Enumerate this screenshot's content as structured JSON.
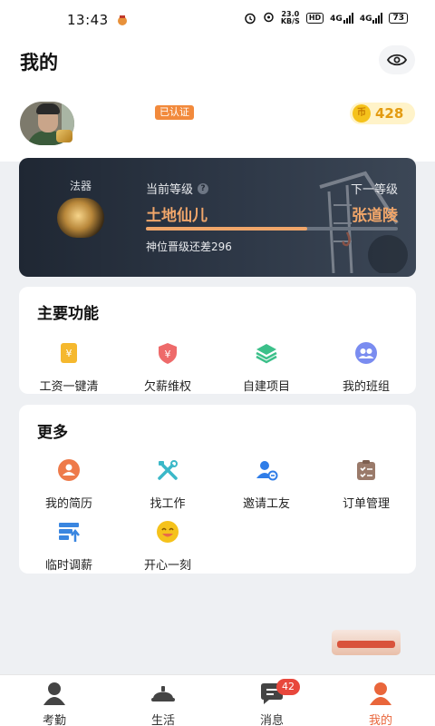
{
  "status_bar": {
    "time": "13:43",
    "net_speed_value": "23.0",
    "net_speed_unit": "KB/S",
    "hd_label": "HD",
    "signal_1": "4G",
    "signal_2": "4G",
    "battery": "73"
  },
  "header": {
    "title": "我的",
    "eye_icon": "eye-icon"
  },
  "profile": {
    "verified_label": "已认证",
    "coins": "428",
    "coin_symbol": "币"
  },
  "level_card": {
    "artifact_label": "法器",
    "current_label": "当前等级",
    "next_label": "下一等级",
    "current_level": "土地仙儿",
    "next_level": "张道陵",
    "progress_text": "神位晋级还差296",
    "progress_fraction": 0.64
  },
  "main_functions": {
    "title": "主要功能",
    "items": [
      {
        "label": "工资一键清",
        "icon": "salary-scroll-icon",
        "color": "#f5b82e"
      },
      {
        "label": "欠薪维权",
        "icon": "shield-yen-icon",
        "color": "#ee6a6a"
      },
      {
        "label": "自建项目",
        "icon": "layers-icon",
        "color": "#3cc08a"
      },
      {
        "label": "我的班组",
        "icon": "team-icon",
        "color": "#7a8cf0"
      }
    ]
  },
  "more": {
    "title": "更多",
    "items": [
      {
        "label": "我的简历",
        "icon": "resume-icon",
        "color": "#ee7a4a"
      },
      {
        "label": "找工作",
        "icon": "tools-icon",
        "color": "#3bb8c8"
      },
      {
        "label": "邀请工友",
        "icon": "invite-user-icon",
        "color": "#2f7de8"
      },
      {
        "label": "订单管理",
        "icon": "clipboard-icon",
        "color": "#9a7a6a"
      },
      {
        "label": "临时调薪",
        "icon": "salary-adjust-icon",
        "color": "#3a86e0"
      },
      {
        "label": "开心一刻",
        "icon": "smile-icon",
        "color": "#f5c21b"
      }
    ]
  },
  "bottom_nav": {
    "items": [
      {
        "label": "考勤",
        "icon": "attendance-icon"
      },
      {
        "label": "生活",
        "icon": "helmet-icon"
      },
      {
        "label": "消息",
        "icon": "message-icon",
        "badge": "42"
      },
      {
        "label": "我的",
        "icon": "profile-icon",
        "active": true
      }
    ]
  },
  "colors": {
    "accent": "#e9663b",
    "level_text": "#f0a66a",
    "coin": "#e39b10"
  }
}
